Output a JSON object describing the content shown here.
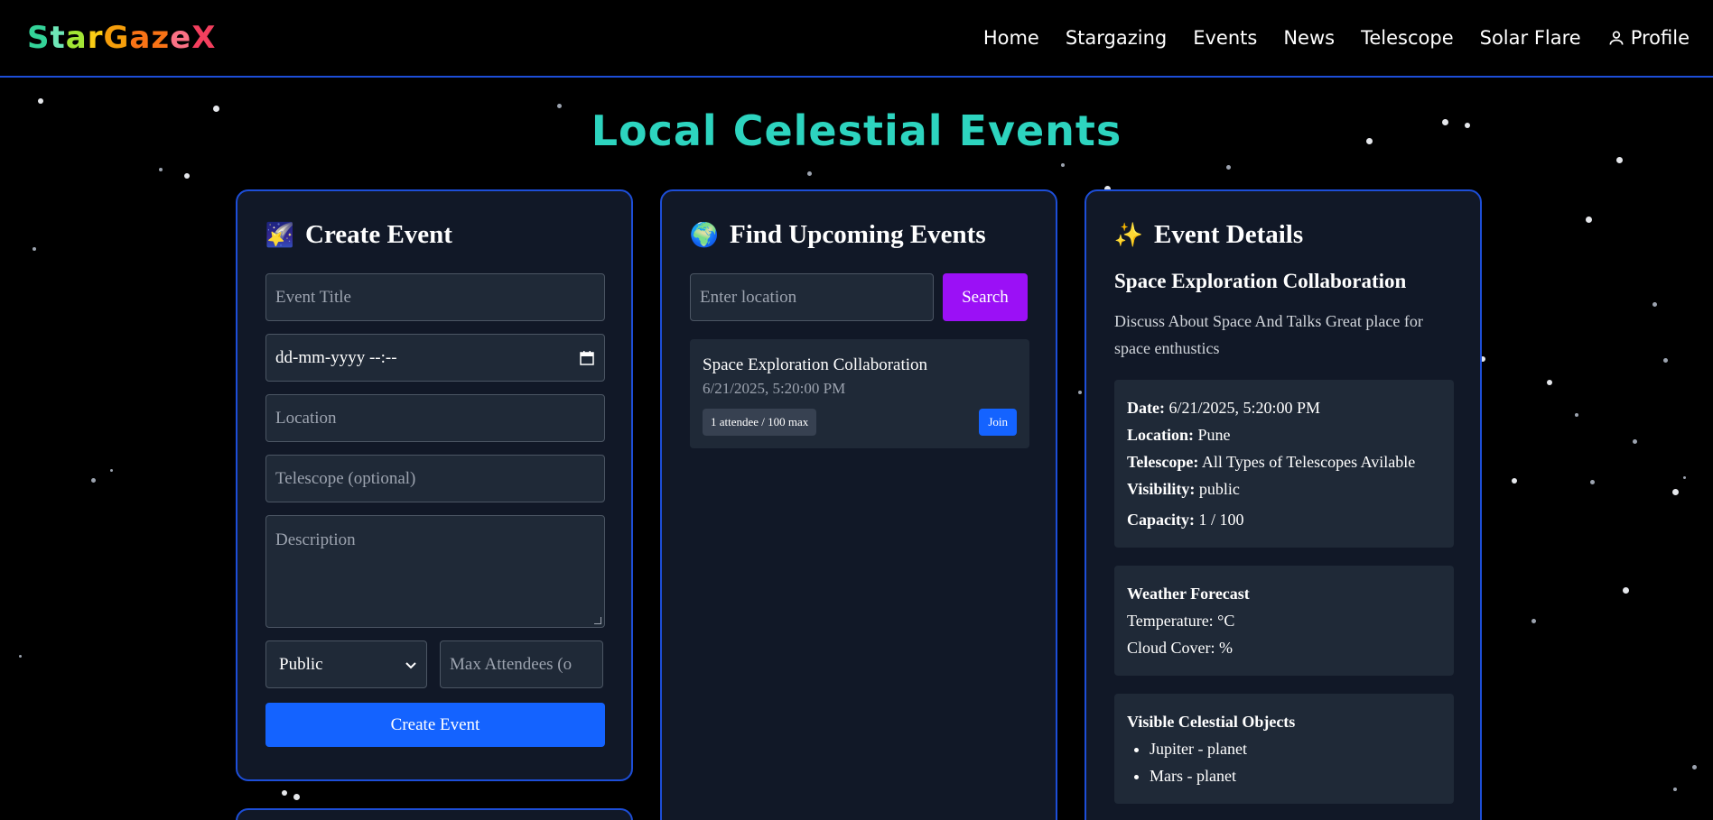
{
  "brand": {
    "name": "StarGazeX"
  },
  "nav": {
    "home": "Home",
    "stargazing": "Stargazing",
    "events": "Events",
    "news": "News",
    "telescope": "Telescope",
    "solar_flare": "Solar Flare",
    "profile": "Profile"
  },
  "page": {
    "title": "Local Celestial Events"
  },
  "create": {
    "emoji": "🌠",
    "heading": "Create Event",
    "title_placeholder": "Event Title",
    "date_value": "dd-mm-yyyy --:--",
    "location_placeholder": "Location",
    "telescope_placeholder": "Telescope (optional)",
    "description_placeholder": "Description",
    "visibility_value": "Public",
    "max_attendees_placeholder": "Max Attendees (o",
    "submit_label": "Create Event"
  },
  "find": {
    "emoji": "🌍",
    "heading": "Find Upcoming Events",
    "location_placeholder": "Enter location",
    "search_label": "Search",
    "events": [
      {
        "title": "Space Exploration Collaboration",
        "datetime": "6/21/2025, 5:20:00 PM",
        "attendees": "1 attendee / 100 max",
        "join_label": "Join"
      }
    ]
  },
  "details": {
    "emoji": "✨",
    "heading": "Event Details",
    "title": "Space Exploration Collaboration",
    "description": "Discuss About Space And Talks Great place for space enthustics",
    "info": {
      "date_label": "Date:",
      "date": "6/21/2025, 5:20:00 PM",
      "location_label": "Location:",
      "location": "Pune",
      "telescope_label": "Telescope:",
      "telescope": "All Types of Telescopes Avilable",
      "visibility_label": "Visibility:",
      "visibility": "public",
      "capacity_label": "Capacity:",
      "capacity": "1 / 100"
    },
    "weather": {
      "heading": "Weather Forecast",
      "temperature": "Temperature: °C",
      "cloud_cover": "Cloud Cover: %"
    },
    "celestial": {
      "heading": "Visible Celestial Objects",
      "items": [
        "Jupiter - planet",
        "Mars - planet"
      ]
    }
  },
  "colors": {
    "accent_blue": "#1463ff",
    "search_purple": "#9b10f6",
    "border_blue": "#1d4ed8",
    "title_teal": "#2dd4bf"
  }
}
